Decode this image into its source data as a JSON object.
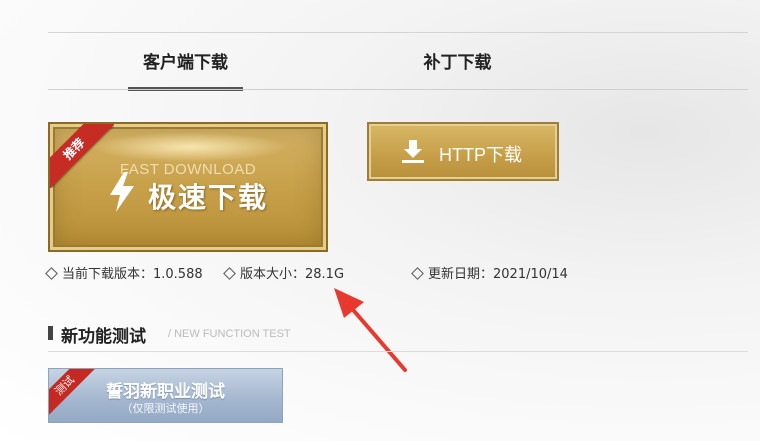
{
  "tabs": {
    "client": "客户端下载",
    "patch": "补丁下载"
  },
  "fast_download": {
    "badge": "推荐",
    "subtitle": "FAST DOWNLOAD",
    "label": "极速下载"
  },
  "http_download": {
    "label": "HTTP下载"
  },
  "info": {
    "version": "当前下载版本：1.0.588",
    "size": "版本大小：28.1G",
    "date": "更新日期：2021/10/14"
  },
  "section": {
    "title": "新功能测试",
    "subtitle": "/ NEW FUNCTION TEST"
  },
  "test_button": {
    "badge": "测试",
    "title": "誓羽新职业测试",
    "note": "（仅限测试使用）"
  },
  "colors": {
    "gold": "#c9a24c",
    "ribbon_red": "#c62b24",
    "test_blue": "#a6b8d0",
    "annotation_red": "#e8392e"
  },
  "icons": [
    "bolt-icon",
    "download-icon",
    "diamond-icon",
    "annotation-arrow"
  ]
}
